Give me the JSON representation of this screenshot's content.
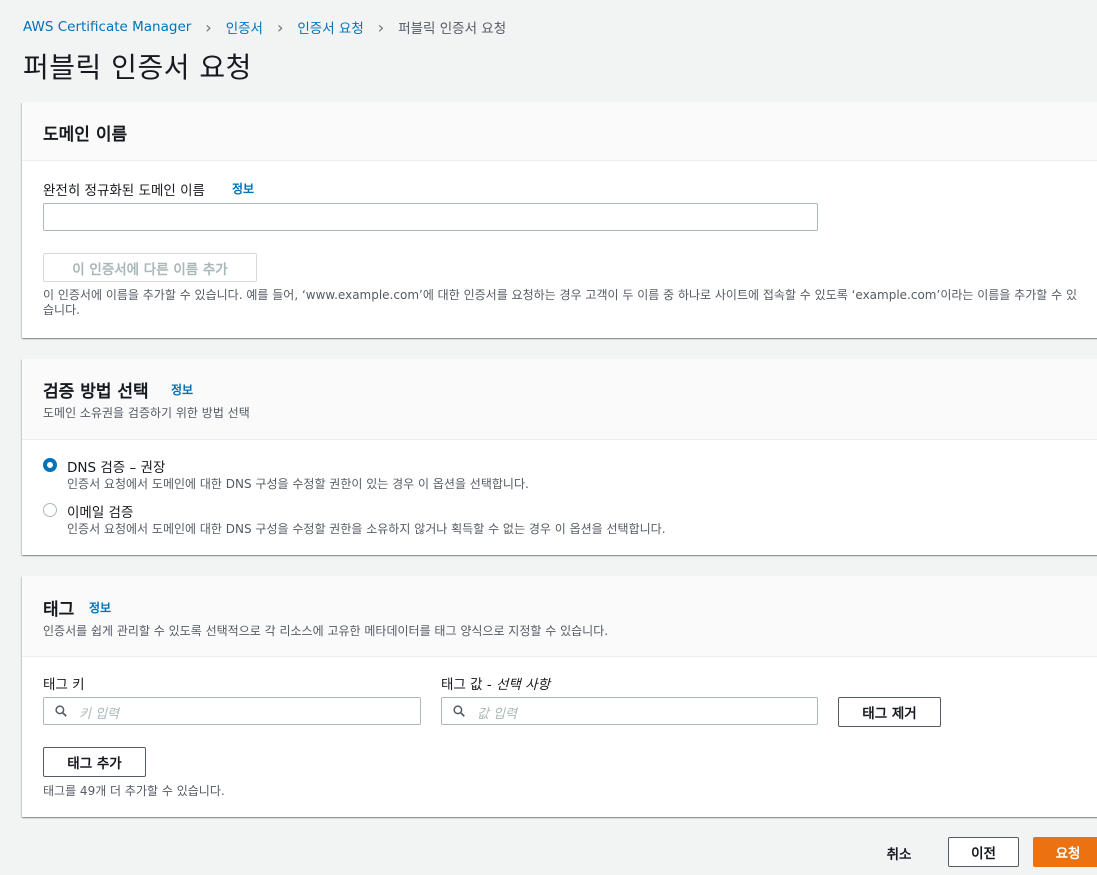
{
  "breadcrumb": {
    "root": "AWS Certificate Manager",
    "level2": "인증서",
    "level3": "인증서 요청",
    "current": "퍼블릭 인증서 요청"
  },
  "page_title": "퍼블릭 인증서 요청",
  "domain_section": {
    "title": "도메인 이름",
    "field_label": "완전히 정규화된 도메인 이름",
    "info": "정보",
    "domain_value": "",
    "add_name_button": "이 인증서에 다른 이름 추가",
    "help_text": "이 인증서에 이름을 추가할 수 있습니다. 예를 들어, ‘www.example.com’에 대한 인증서를 요청하는 경우 고객이 두 이름 중 하나로 사이트에 접속할 수 있도록 ‘example.com’이라는 이름을 추가할 수 있습니다."
  },
  "validation_section": {
    "title": "검증 방법 선택",
    "info": "정보",
    "description": "도메인 소유권을 검증하기 위한 방법 선택",
    "options": [
      {
        "label": "DNS 검증 – 권장",
        "description": "인증서 요청에서 도메인에 대한 DNS 구성을 수정할 권한이 있는 경우 이 옵션을 선택합니다.",
        "selected": true
      },
      {
        "label": "이메일 검증",
        "description": "인증서 요청에서 도메인에 대한 DNS 구성을 수정할 권한을 소유하지 않거나 획득할 수 없는 경우 이 옵션을 선택합니다.",
        "selected": false
      }
    ]
  },
  "tags_section": {
    "title": "태그",
    "info": "정보",
    "description": "인증서를 쉽게 관리할 수 있도록 선택적으로 각 리소스에 고유한 메타데이터를 태그 양식으로 지정할 수 있습니다.",
    "key_label": "태그 키",
    "value_label_prefix": "태그 값 - ",
    "value_label_optional": "선택 사항",
    "key_placeholder": "키 입력",
    "value_placeholder": "값 입력",
    "remove_button": "태그 제거",
    "add_button": "태그 추가",
    "remaining_text": "태그를 49개 더 추가할 수 있습니다."
  },
  "footer": {
    "cancel": "취소",
    "previous": "이전",
    "submit": "요청"
  },
  "colors": {
    "link": "#0073bb",
    "primary": "#ec7211",
    "background": "#f2f3f3"
  }
}
